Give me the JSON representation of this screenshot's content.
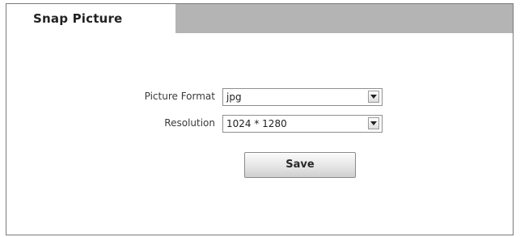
{
  "tab": {
    "title": "Snap Picture"
  },
  "form": {
    "picture_format": {
      "label": "Picture Format",
      "selected": "jpg"
    },
    "resolution": {
      "label": "Resolution",
      "selected": "1024 * 1280"
    }
  },
  "actions": {
    "save_label": "Save"
  },
  "icons": {
    "dropdown": "chevron-down-icon"
  },
  "colors": {
    "tab_background": "#b4b4b4",
    "panel_border": "#7a7a7a"
  }
}
